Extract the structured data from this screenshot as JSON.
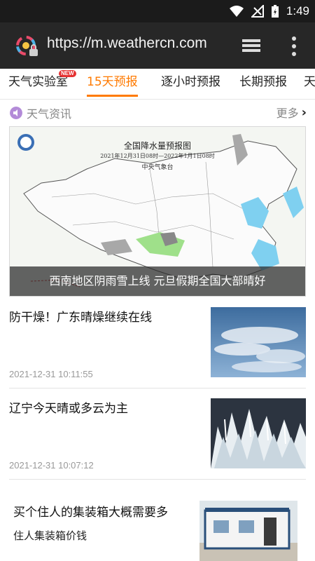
{
  "status_bar": {
    "time": "1:49",
    "icons": [
      "wifi-icon",
      "signal-icon",
      "battery-icon"
    ]
  },
  "browser": {
    "url": "https://m.weathercn.com",
    "icons": [
      "site-favicon-icon",
      "tabs-icon",
      "more-vert-icon"
    ]
  },
  "nav": {
    "tabs": [
      {
        "label": "天气实验室",
        "badge": "NEW",
        "active": false
      },
      {
        "label": "15天预报",
        "active": true
      },
      {
        "label": "逐小时预报",
        "active": false
      },
      {
        "label": "长期预报",
        "active": false
      },
      {
        "label": "天",
        "active": false
      }
    ]
  },
  "section": {
    "title": "天气资讯",
    "more_label": "更多",
    "icon": "speaker-icon"
  },
  "feature": {
    "map_title": "全国降水量预报图",
    "map_period": "2021年12月31日08时—2022年1月1日08时",
    "map_org": "中央气象台",
    "caption": "西南地区阴雨雪上线 元旦假期全国大部晴好"
  },
  "news": [
    {
      "title": "防干燥！广东晴燥继续在线",
      "time": "2021-12-31 10:11:55",
      "thumb": "blue-sky-clouds-photo"
    },
    {
      "title": "辽宁今天晴或多云为主",
      "time": "2021-12-31 10:07:12",
      "thumb": "frozen-ice-trees-photo"
    }
  ],
  "ad": {
    "title": "买个住人的集装箱大概需要多",
    "subtitle": "住人集装箱价钱",
    "thumb": "container-house-photo"
  },
  "colors": {
    "accent": "#ff7a00",
    "status_bar": "#1b1b1b",
    "browser_bar": "#272727",
    "badge": "#e63232"
  }
}
